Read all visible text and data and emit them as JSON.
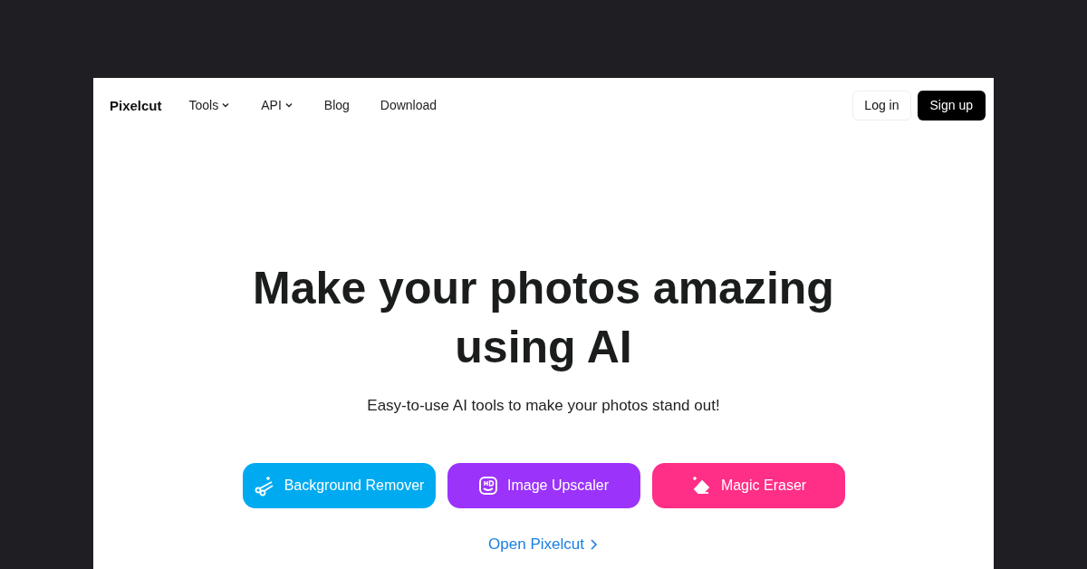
{
  "nav": {
    "logo": "Pixelcut",
    "links": [
      {
        "label": "Tools",
        "dropdown": true
      },
      {
        "label": "API",
        "dropdown": true
      },
      {
        "label": "Blog",
        "dropdown": false
      },
      {
        "label": "Download",
        "dropdown": false
      }
    ],
    "login": "Log in",
    "signup": "Sign up"
  },
  "hero": {
    "title": "Make your photos amazing using AI",
    "subtitle": "Easy-to-use AI tools to make your photos stand out!",
    "tools": [
      {
        "label": "Background Remover",
        "kind": "scissors",
        "color": "#00aaf0"
      },
      {
        "label": "Image Upscaler",
        "kind": "hd",
        "color": "#9b33fb"
      },
      {
        "label": "Magic Eraser",
        "kind": "eraser",
        "color": "#ff2e86"
      }
    ],
    "link": "Open Pixelcut"
  }
}
